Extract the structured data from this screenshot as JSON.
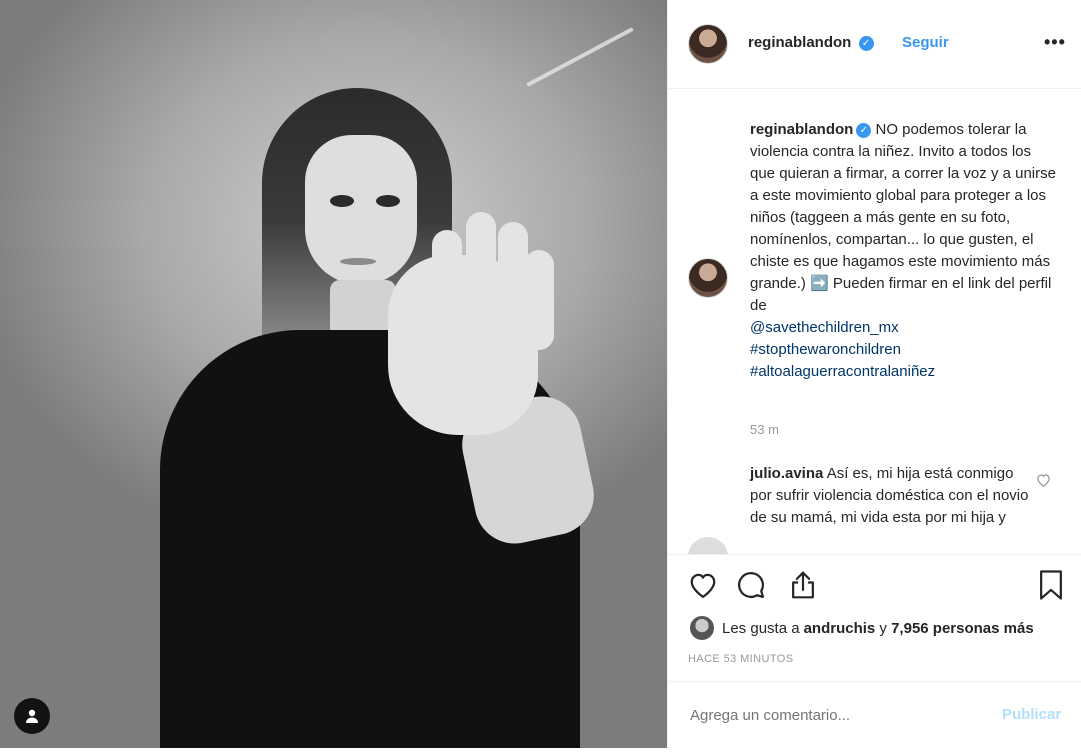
{
  "header": {
    "username": "reginablandon",
    "verified_badge": "✓",
    "follow_label": "Seguir",
    "more_label": "•••"
  },
  "caption": {
    "username": "reginablandon",
    "text": " NO podemos tolerar la violencia contra la niñez. Invito a todos los que quieran a firmar, a correr la voz y a unirse a este movimiento global para proteger a los niños (taggeen a más gente en su foto, nomínenlos, compartan... lo que gusten, el chiste es que hagamos este movimiento más grande.) ➡️ Pueden firmar en el link del perfil de",
    "mention": "@savethechildren_mx",
    "hashtags": [
      "#stopthewaronchildren",
      "#altoalaguerracontralaniñez"
    ],
    "time": "53 m"
  },
  "comment": {
    "username": "julio.avina",
    "text": " Así es, mi hija está conmigo por sufrir violencia doméstica con el novio de su mamá, mi vida esta por mi hija y"
  },
  "likes": {
    "prefix": "Les gusta a ",
    "user": "andruchis",
    "middle": " y ",
    "count": "7,956 personas más"
  },
  "posted": "HACE 53 MINUTOS",
  "add_comment": {
    "placeholder": "Agrega un comentario...",
    "publish_label": "Publicar"
  },
  "colors": {
    "accent": "#3897f0",
    "link": "#003569",
    "muted": "#999999"
  },
  "icons": [
    "user-tag-icon",
    "heart-icon",
    "comment-icon",
    "share-icon",
    "bookmark-icon",
    "heart-small-icon",
    "verified-icon"
  ]
}
